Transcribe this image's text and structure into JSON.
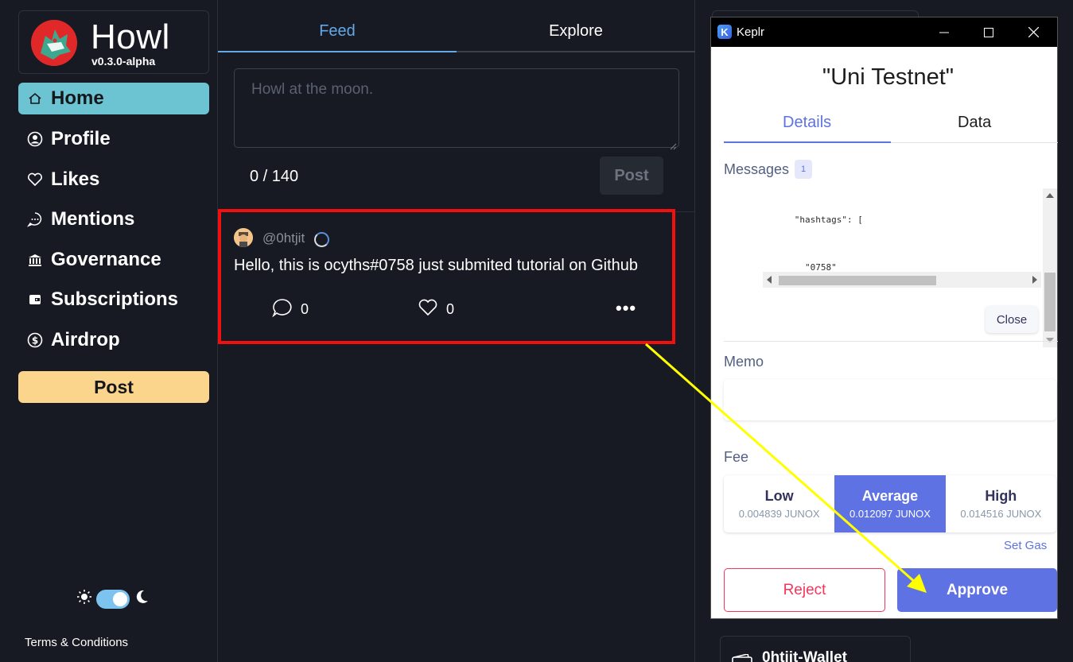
{
  "app": {
    "name": "Howl",
    "version": "v0.3.0-alpha"
  },
  "sidebar": {
    "items": [
      {
        "label": "Home",
        "icon": "home-icon",
        "active": true
      },
      {
        "label": "Profile",
        "icon": "user-circle-icon",
        "active": false
      },
      {
        "label": "Likes",
        "icon": "heart-icon",
        "active": false
      },
      {
        "label": "Mentions",
        "icon": "chat-bubble-icon",
        "active": false
      },
      {
        "label": "Governance",
        "icon": "bank-icon",
        "active": false
      },
      {
        "label": "Subscriptions",
        "icon": "wallet-icon",
        "active": false
      },
      {
        "label": "Airdrop",
        "icon": "dollar-coin-icon",
        "active": false
      }
    ],
    "post_label": "Post",
    "terms": "Terms & Conditions"
  },
  "main": {
    "tabs": [
      "Feed",
      "Explore"
    ],
    "active_tab": "Feed",
    "composer_placeholder": "Howl at the moon.",
    "char_count": "0 / 140",
    "post_label": "Post",
    "post": {
      "handle": "@0htjit",
      "text": "Hello, this is ocyths#0758 just submited tutorial on Github",
      "comments": "0",
      "likes": "0"
    }
  },
  "wallet": {
    "name": "0htjit-Wallet"
  },
  "keplr": {
    "window_title": "Keplr",
    "chain_title": "\"Uni Testnet\"",
    "tabs": [
      "Details",
      "Data"
    ],
    "messages_label": "Messages",
    "messages_count": "1",
    "code_lines": [
      "      \"hashtags\": [",
      "        \"0758\"",
      "      ]",
      "    }",
      "  }",
      "}"
    ],
    "close_label": "Close",
    "memo_label": "Memo",
    "fee_label": "Fee",
    "fees": [
      {
        "name": "Low",
        "amount": "0.004839 JUNOX",
        "selected": false
      },
      {
        "name": "Average",
        "amount": "0.012097 JUNOX",
        "selected": true
      },
      {
        "name": "High",
        "amount": "0.014516 JUNOX",
        "selected": false
      }
    ],
    "set_gas_label": "Set Gas",
    "reject_label": "Reject",
    "approve_label": "Approve"
  },
  "colors": {
    "background": "#171a23",
    "active_nav": "#6cc4d3",
    "post_button": "#fcd58d",
    "feed_accent": "#63a9e8",
    "keplr_accent": "#5e72e4",
    "reject": "#f5365c",
    "highlight_box": "#f40f0f",
    "annotation_arrow": "#ffff00"
  }
}
